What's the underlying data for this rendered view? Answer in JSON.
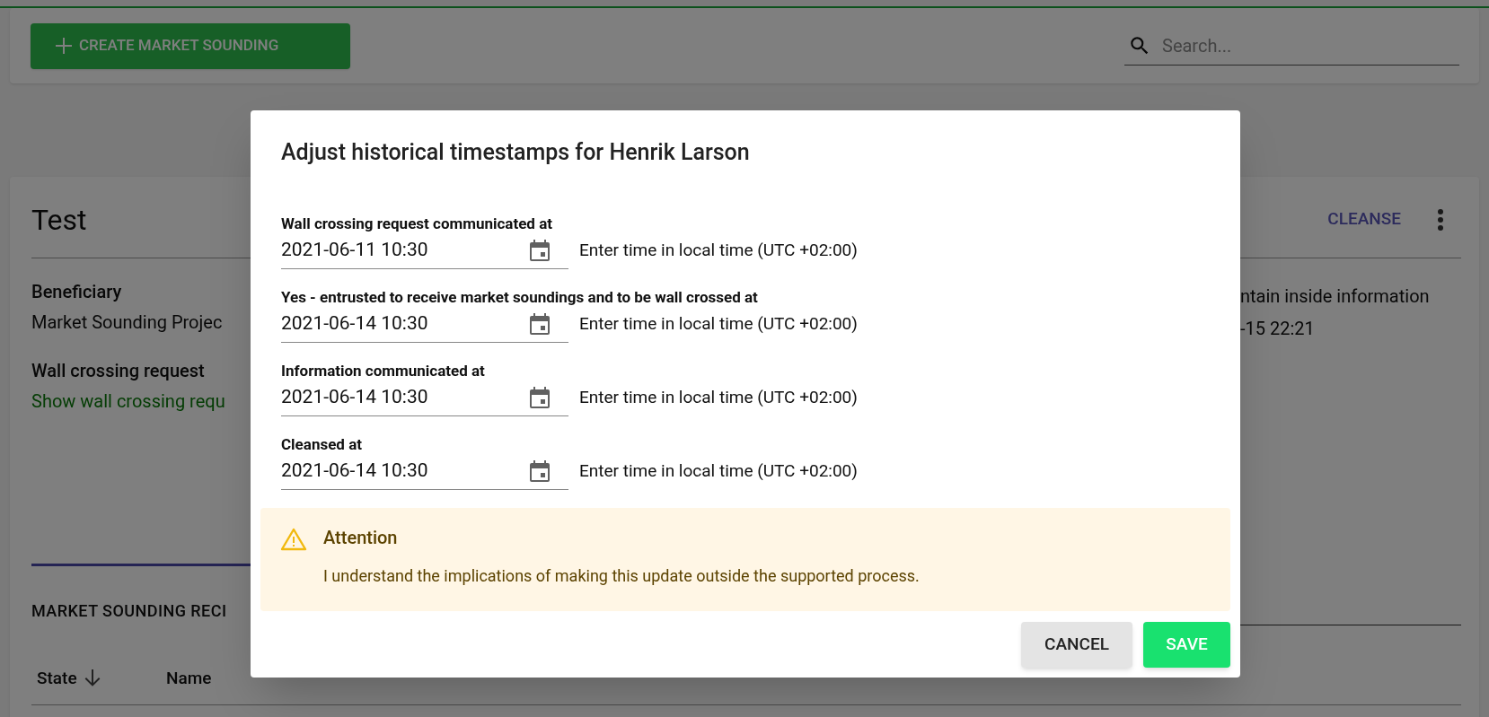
{
  "toolbar": {
    "create_button": "CREATE MARKET SOUNDING",
    "search": {
      "placeholder": "Search..."
    }
  },
  "card": {
    "title": "Test",
    "cleanse_button": "CLEANSE",
    "left": [
      {
        "kind": "label",
        "text": "Beneficiary"
      },
      {
        "kind": "value",
        "text": "Market Sounding Projec"
      },
      {
        "kind": "label",
        "text": "Wall crossing request"
      },
      {
        "kind": "link",
        "text": "Show wall crossing requ"
      }
    ],
    "right": [
      "ntain inside information",
      "-15 22:21"
    ],
    "section_title": "MARKET SOUNDING RECI",
    "columns": [
      {
        "label": "State",
        "sorted": true
      },
      {
        "label": "Name",
        "sorted": false
      }
    ]
  },
  "dialog": {
    "title": "Adjust historical timestamps for Henrik Larson",
    "fields": [
      {
        "label": "Wall crossing request communicated at",
        "value": "2021-06-11 10:30",
        "hint": "Enter time in local time (UTC +02:00)"
      },
      {
        "label": "Yes - entrusted to receive market soundings and to be wall crossed at",
        "value": "2021-06-14 10:30",
        "hint": "Enter time in local time (UTC +02:00)"
      },
      {
        "label": "Information communicated at",
        "value": "2021-06-14 10:30",
        "hint": "Enter time in local time (UTC +02:00)"
      },
      {
        "label": "Cleansed at",
        "value": "2021-06-14 10:30",
        "hint": "Enter time in local time (UTC +02:00)"
      }
    ],
    "alert": {
      "title": "Attention",
      "message": "I understand the implications of making this update outside the supported process."
    },
    "buttons": [
      {
        "kind": "secondary",
        "label": "CANCEL"
      },
      {
        "kind": "primary",
        "label": "SAVE"
      }
    ]
  }
}
